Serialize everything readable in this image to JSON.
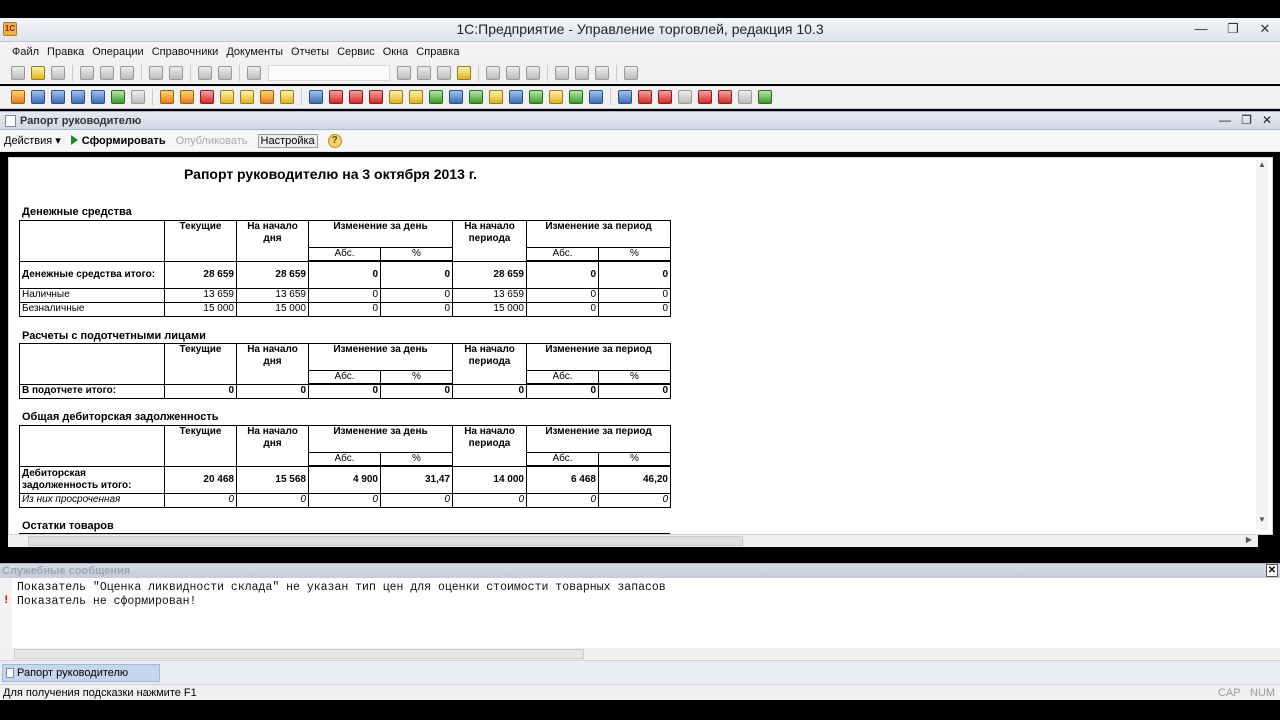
{
  "window": {
    "title": "1С:Предприятие - Управление торговлей, редакция 10.3",
    "app_icon": "1С"
  },
  "menu": [
    "Файл",
    "Правка",
    "Операции",
    "Справочники",
    "Документы",
    "Отчеты",
    "Сервис",
    "Окна",
    "Справка"
  ],
  "document": {
    "title": "Рапорт руководителю"
  },
  "actions": {
    "actions": "Действия ▾",
    "generate": "Сформировать",
    "publish": "Опубликовать",
    "settings": "Настройка",
    "help": "?"
  },
  "report": {
    "title": "Рапорт руководителю на 3 октября 2013 г.",
    "headers": {
      "current": "Текущие",
      "day_start": "На начало дня",
      "day_change": "Изменение за день",
      "period_start": "На начало периода",
      "period_change": "Изменение за период",
      "abs": "Абс.",
      "pct": "%"
    },
    "cash": {
      "section": "Денежные средства",
      "rows": [
        {
          "label": "Денежные средства итого:",
          "cur": "28 659",
          "day": "28 659",
          "dabs": "0",
          "dpct": "0",
          "per": "28 659",
          "pabs": "0",
          "ppct": "0"
        },
        {
          "label": "Наличные",
          "cur": "13 659",
          "day": "13 659",
          "dabs": "0",
          "dpct": "0",
          "per": "13 659",
          "pabs": "0",
          "ppct": "0"
        },
        {
          "label": "Безналичные",
          "cur": "15 000",
          "day": "15 000",
          "dabs": "0",
          "dpct": "0",
          "per": "15 000",
          "pabs": "0",
          "ppct": "0"
        }
      ]
    },
    "accountable": {
      "section": "Расчеты с подотчетными лицами",
      "rows": [
        {
          "label": "В подотчете итого:",
          "cur": "0",
          "day": "0",
          "dabs": "0",
          "dpct": "0",
          "per": "0",
          "pabs": "0",
          "ppct": "0"
        }
      ]
    },
    "receivables": {
      "section": "Общая дебиторская задолженность",
      "rows": [
        {
          "label": "Дебиторская задолженность итого:",
          "cur": "20 468",
          "day": "15 568",
          "dabs": "4 900",
          "dpct": "31,47",
          "per": "14 000",
          "pabs": "6 468",
          "ppct": "46,20"
        },
        {
          "label": "Из них просроченная",
          "cur": "0",
          "day": "0",
          "dabs": "0",
          "dpct": "0",
          "per": "0",
          "pabs": "0",
          "ppct": "0"
        }
      ]
    },
    "stock": {
      "section": "Остатки товаров"
    }
  },
  "messages": {
    "panel_title": "Служебные сообщения",
    "close": "✕",
    "lines": [
      "Показатель \"Оценка ликвидности склада\" не указан тип цен для оценки стоимости товарных запасов",
      "Показатель не сформирован!"
    ],
    "marker": "!"
  },
  "taskbar": {
    "item": "Рапорт руководителю"
  },
  "status": {
    "hint": "Для получения подсказки нажмите F1",
    "cap": "CAP",
    "num": "NUM"
  }
}
